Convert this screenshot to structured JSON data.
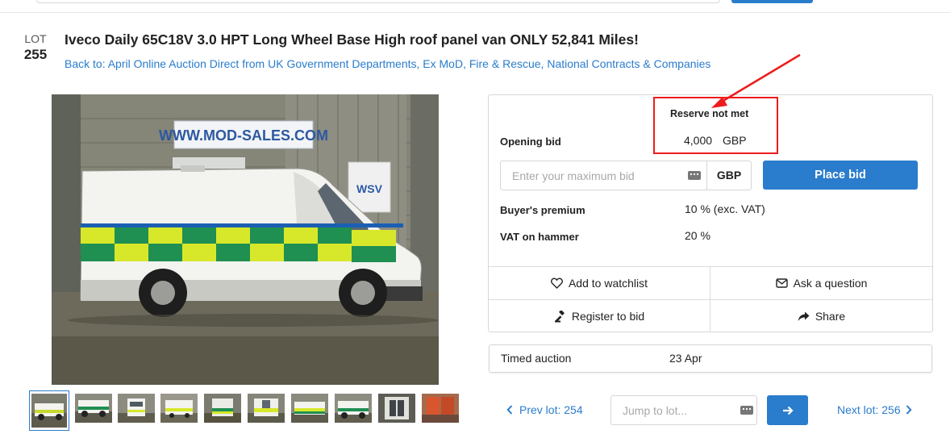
{
  "lot": {
    "label": "LOT",
    "number": "255",
    "title": "Iveco Daily 65C18V 3.0 HPT Long Wheel Base High roof panel van ONLY 52,841 Miles!",
    "back_link": "Back to: April Online Auction Direct from UK Government Departments, Ex MoD, Fire & Rescue, National Contracts & Companies"
  },
  "image": {
    "banner_text": "WWW.MOD-SALES.COM",
    "sign_text": "WSV",
    "thumbnail_count": 10
  },
  "bidding": {
    "reserve_status": "Reserve not met",
    "opening_bid_label": "Opening bid",
    "opening_bid_amount": "4,000",
    "opening_bid_currency": "GBP",
    "max_bid_placeholder": "Enter your maximum bid",
    "currency": "GBP",
    "place_bid_label": "Place bid",
    "buyers_premium_label": "Buyer's premium",
    "buyers_premium_value": "10 % (exc. VAT)",
    "vat_label": "VAT on hammer",
    "vat_value": "20 %"
  },
  "actions": {
    "watchlist": "Add to watchlist",
    "ask_question": "Ask a question",
    "register": "Register to bid",
    "share": "Share"
  },
  "auction": {
    "type": "Timed auction",
    "date": "23 Apr"
  },
  "navigation": {
    "prev_lot": "Prev lot: 254",
    "jump_placeholder": "Jump to lot...",
    "next_lot": "Next lot: 256"
  },
  "colors": {
    "accent": "#2a7ccc",
    "annotation": "#ee1c1c"
  }
}
